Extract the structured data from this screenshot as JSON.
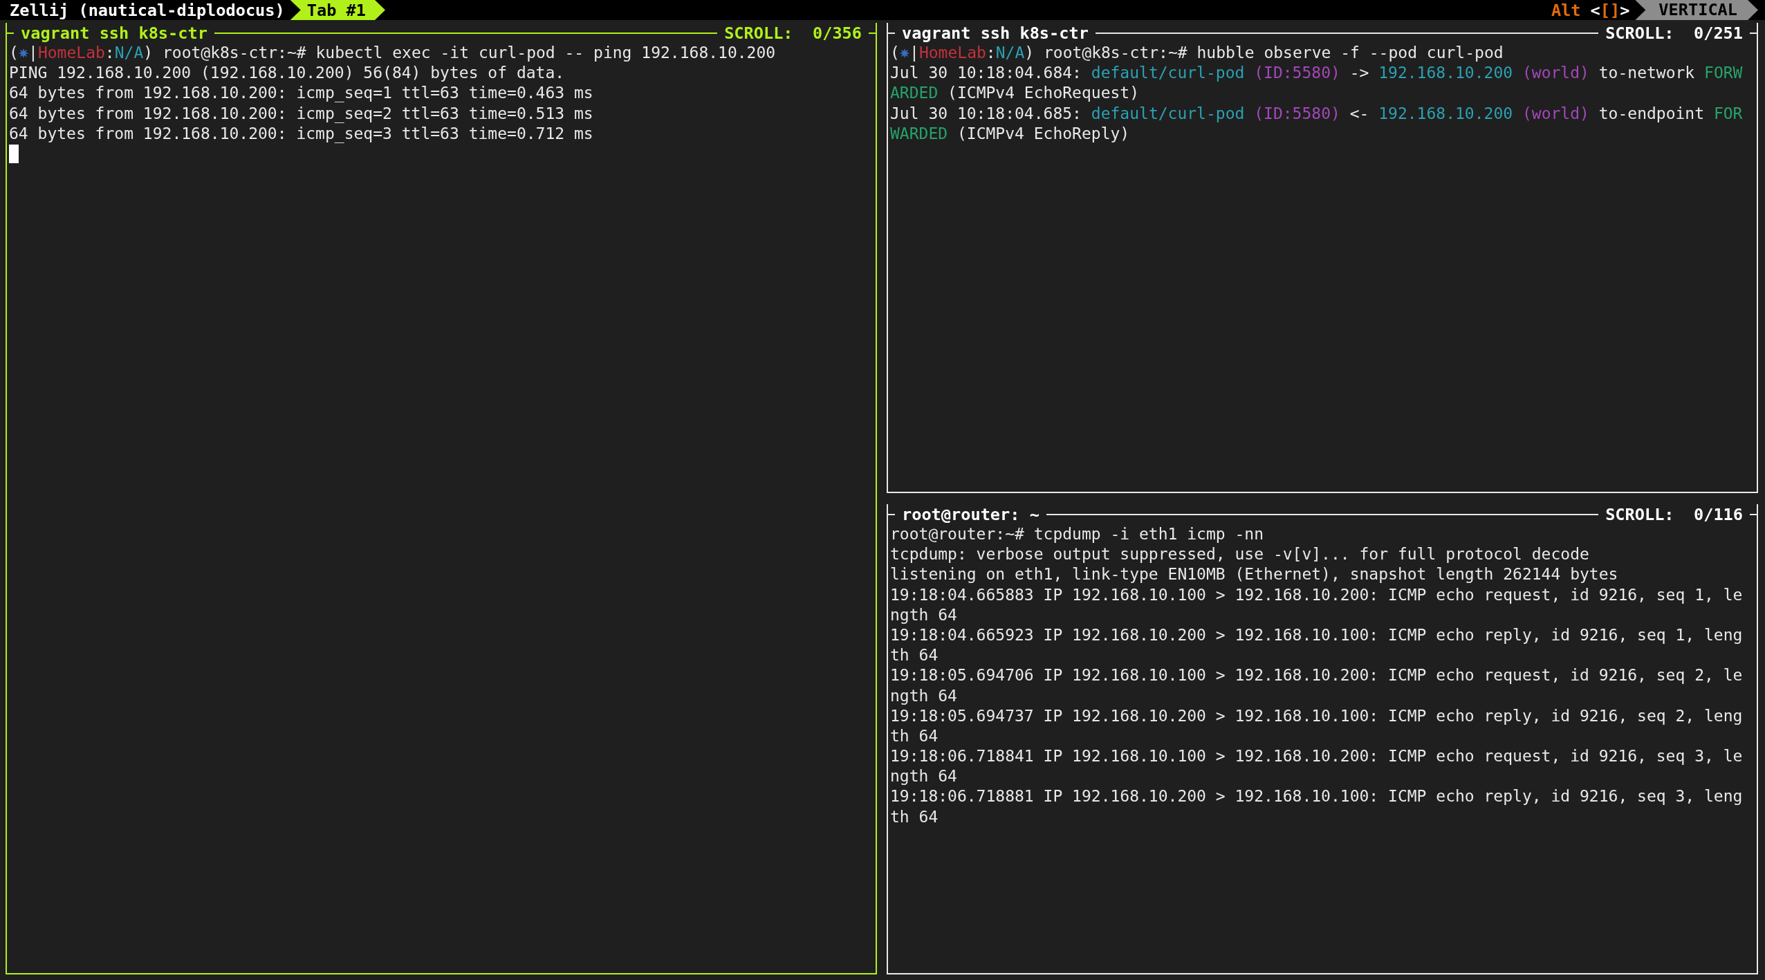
{
  "session": {
    "title": "Zellij (nautical-diplodocus)"
  },
  "tabs": [
    {
      "label": "Tab #1",
      "selected": true
    }
  ],
  "hint": {
    "key": "Alt",
    "open": "<",
    "keys": "[]",
    "close": ">",
    "mode": "VERTICAL"
  },
  "panes": [
    {
      "title": "vagrant ssh k8s-ctr",
      "scroll": "SCROLL:  0/356",
      "focused": true,
      "cursor": true,
      "lines": [
        [
          {
            "kind": "text",
            "t": "("
          },
          {
            "kind": "helm"
          },
          {
            "kind": "text",
            "t": "|"
          },
          {
            "kind": "text",
            "t": "HomeLab",
            "color": "#c4313c"
          },
          {
            "kind": "text",
            "t": ":"
          },
          {
            "kind": "text",
            "t": "N/A",
            "color": "#2aa1b3"
          },
          {
            "kind": "text",
            "t": ") root@k8s-ctr:~# kubectl exec -it curl-pod -- ping 192.168.10.200"
          }
        ],
        [
          {
            "kind": "text",
            "t": "PING 192.168.10.200 (192.168.10.200) 56(84) bytes of data."
          }
        ],
        [
          {
            "kind": "text",
            "t": "64 bytes from 192.168.10.200: icmp_seq=1 ttl=63 time=0.463 ms"
          }
        ],
        [
          {
            "kind": "text",
            "t": "64 bytes from 192.168.10.200: icmp_seq=2 ttl=63 time=0.513 ms"
          }
        ],
        [
          {
            "kind": "text",
            "t": "64 bytes from 192.168.10.200: icmp_seq=3 ttl=63 time=0.712 ms"
          }
        ]
      ]
    },
    {
      "title": "vagrant ssh k8s-ctr",
      "scroll": "SCROLL:  0/251",
      "focused": false,
      "cursor": false,
      "lines": [
        [
          {
            "kind": "text",
            "t": "("
          },
          {
            "kind": "helm"
          },
          {
            "kind": "text",
            "t": "|"
          },
          {
            "kind": "text",
            "t": "HomeLab",
            "color": "#c4313c"
          },
          {
            "kind": "text",
            "t": ":"
          },
          {
            "kind": "text",
            "t": "N/A",
            "color": "#2aa1b3"
          },
          {
            "kind": "text",
            "t": ") root@k8s-ctr:~# hubble observe -f --pod curl-pod"
          }
        ],
        [
          {
            "kind": "text",
            "t": "Jul 30 10:18:04.684: "
          },
          {
            "kind": "text",
            "t": "default/curl-pod",
            "color": "#2aa1b3"
          },
          {
            "kind": "text",
            "t": " (ID:5580)",
            "color": "#a347ba"
          },
          {
            "kind": "text",
            "t": " -> "
          },
          {
            "kind": "text",
            "t": "192.168.10.200",
            "color": "#2aa1b3"
          },
          {
            "kind": "text",
            "t": " (world)",
            "color": "#a347ba"
          },
          {
            "kind": "text",
            "t": " to-network "
          },
          {
            "kind": "text",
            "t": "FORW",
            "color": "#26a269"
          }
        ],
        [
          {
            "kind": "text",
            "t": "ARDED",
            "color": "#26a269"
          },
          {
            "kind": "text",
            "t": " (ICMPv4 EchoRequest)"
          }
        ],
        [
          {
            "kind": "text",
            "t": "Jul 30 10:18:04.685: "
          },
          {
            "kind": "text",
            "t": "default/curl-pod",
            "color": "#2aa1b3"
          },
          {
            "kind": "text",
            "t": " (ID:5580)",
            "color": "#a347ba"
          },
          {
            "kind": "text",
            "t": " <- "
          },
          {
            "kind": "text",
            "t": "192.168.10.200",
            "color": "#2aa1b3"
          },
          {
            "kind": "text",
            "t": " (world)",
            "color": "#a347ba"
          },
          {
            "kind": "text",
            "t": " to-endpoint "
          },
          {
            "kind": "text",
            "t": "FOR",
            "color": "#26a269"
          }
        ],
        [
          {
            "kind": "text",
            "t": "WARDED",
            "color": "#26a269"
          },
          {
            "kind": "text",
            "t": " (ICMPv4 EchoReply)"
          }
        ]
      ]
    },
    {
      "title": "root@router: ~",
      "scroll": "SCROLL:  0/116",
      "focused": false,
      "cursor": false,
      "lines": [
        [
          {
            "kind": "text",
            "t": "root@router:~# tcpdump -i eth1 icmp -nn"
          }
        ],
        [
          {
            "kind": "text",
            "t": "tcpdump: verbose output suppressed, use -v[v]... for full protocol decode"
          }
        ],
        [
          {
            "kind": "text",
            "t": "listening on eth1, link-type EN10MB (Ethernet), snapshot length 262144 bytes"
          }
        ],
        [
          {
            "kind": "text",
            "t": "19:18:04.665883 IP 192.168.10.100 > 192.168.10.200: ICMP echo request, id 9216, seq 1, le"
          }
        ],
        [
          {
            "kind": "text",
            "t": "ngth 64"
          }
        ],
        [
          {
            "kind": "text",
            "t": "19:18:04.665923 IP 192.168.10.200 > 192.168.10.100: ICMP echo reply, id 9216, seq 1, leng"
          }
        ],
        [
          {
            "kind": "text",
            "t": "th 64"
          }
        ],
        [
          {
            "kind": "text",
            "t": "19:18:05.694706 IP 192.168.10.100 > 192.168.10.200: ICMP echo request, id 9216, seq 2, le"
          }
        ],
        [
          {
            "kind": "text",
            "t": "ngth 64"
          }
        ],
        [
          {
            "kind": "text",
            "t": "19:18:05.694737 IP 192.168.10.200 > 192.168.10.100: ICMP echo reply, id 9216, seq 2, leng"
          }
        ],
        [
          {
            "kind": "text",
            "t": "th 64"
          }
        ],
        [
          {
            "kind": "text",
            "t": "19:18:06.718841 IP 192.168.10.100 > 192.168.10.200: ICMP echo request, id 9216, seq 3, le"
          }
        ],
        [
          {
            "kind": "text",
            "t": "ngth 64"
          }
        ],
        [
          {
            "kind": "text",
            "t": "19:18:06.718881 IP 192.168.10.200 > 192.168.10.100: ICMP echo reply, id 9216, seq 3, leng"
          }
        ],
        [
          {
            "kind": "text",
            "t": "th 64"
          }
        ]
      ]
    }
  ]
}
